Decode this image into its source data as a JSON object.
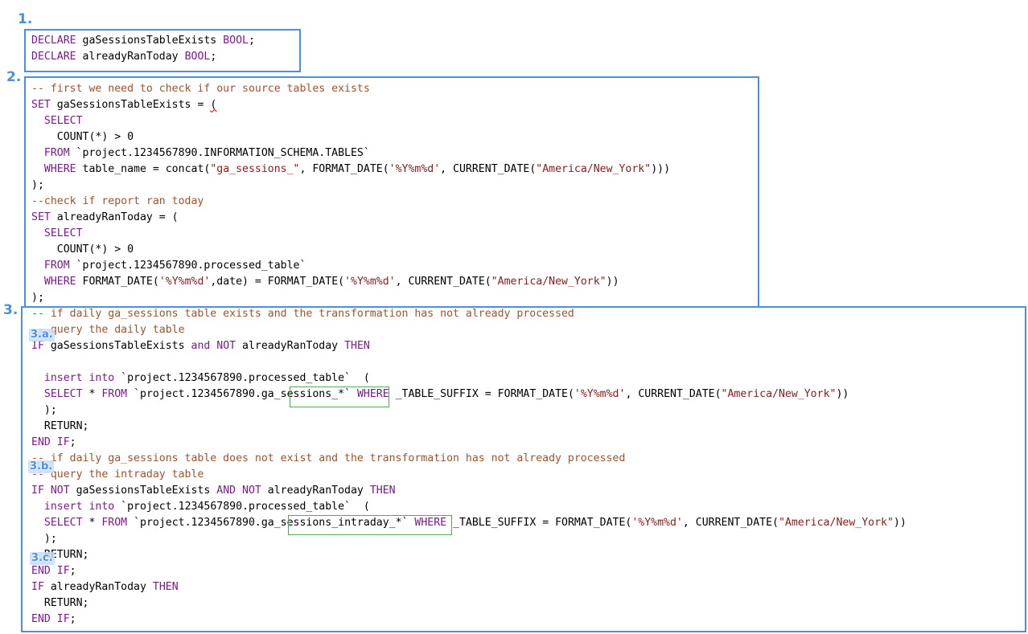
{
  "annotations": {
    "section_1": "1.",
    "section_2": "2.",
    "section_3": "3.",
    "section_3a": "3.a.",
    "section_3b": "3.b.",
    "section_3c": "3.c."
  },
  "colors": {
    "keyword": "#7a1a8c",
    "comment": "#a0522d",
    "string": "#8b1a1a",
    "box": "#4a8fe0",
    "highlight": "#4caf50"
  },
  "code_lines": [
    [
      [
        "kw",
        "DECLARE"
      ],
      [
        "t",
        " gaSessionsTableExists "
      ],
      [
        "kw",
        "BOOL"
      ],
      [
        "t",
        ";"
      ]
    ],
    [
      [
        "kw",
        "DECLARE"
      ],
      [
        "t",
        " alreadyRanToday "
      ],
      [
        "kw",
        "BOOL"
      ],
      [
        "t",
        ";"
      ]
    ],
    [
      [
        "t",
        ""
      ]
    ],
    [
      [
        "cmt",
        "-- first we need to check if our source tables exists"
      ]
    ],
    [
      [
        "kw",
        "SET"
      ],
      [
        "t",
        " gaSessionsTableExists = "
      ],
      [
        "sq",
        "("
      ]
    ],
    [
      [
        "t",
        "  "
      ],
      [
        "kw",
        "SELECT"
      ]
    ],
    [
      [
        "t",
        "    COUNT(*) > 0"
      ]
    ],
    [
      [
        "t",
        "  "
      ],
      [
        "kw",
        "FROM"
      ],
      [
        "t",
        " `project.1234567890.INFORMATION_SCHEMA.TABLES`"
      ]
    ],
    [
      [
        "t",
        "  "
      ],
      [
        "kw",
        "WHERE"
      ],
      [
        "t",
        " table_name = concat("
      ],
      [
        "str",
        "\"ga_sessions_\""
      ],
      [
        "t",
        ", FORMAT_DATE("
      ],
      [
        "str",
        "'%Y%m%d'"
      ],
      [
        "t",
        ", CURRENT_DATE("
      ],
      [
        "str",
        "\"America/New_York\""
      ],
      [
        "t",
        ")))"
      ]
    ],
    [
      [
        "t",
        ");"
      ]
    ],
    [
      [
        "cmt",
        "--check if report ran today"
      ]
    ],
    [
      [
        "kw",
        "SET"
      ],
      [
        "t",
        " alreadyRanToday = ("
      ]
    ],
    [
      [
        "t",
        "  "
      ],
      [
        "kw",
        "SELECT"
      ]
    ],
    [
      [
        "t",
        "    COUNT(*) > 0"
      ]
    ],
    [
      [
        "t",
        "  "
      ],
      [
        "kw",
        "FROM"
      ],
      [
        "t",
        " `project.1234567890.processed_table`"
      ]
    ],
    [
      [
        "t",
        "  "
      ],
      [
        "kw",
        "WHERE"
      ],
      [
        "t",
        " FORMAT_DATE("
      ],
      [
        "str",
        "'%Y%m%d'"
      ],
      [
        "t",
        ",date) = FORMAT_DATE("
      ],
      [
        "str",
        "'%Y%m%d'"
      ],
      [
        "t",
        ", CURRENT_DATE("
      ],
      [
        "str",
        "\"America/New_York\""
      ],
      [
        "t",
        "))"
      ]
    ],
    [
      [
        "t",
        ");"
      ]
    ],
    [
      [
        "cmt",
        "-- if daily ga_sessions table exists and the transformation has not already processed"
      ]
    ],
    [
      [
        "cmt",
        "-- query the daily table"
      ]
    ],
    [
      [
        "kw",
        "IF"
      ],
      [
        "t",
        " gaSessionsTableExists "
      ],
      [
        "kw",
        "and NOT"
      ],
      [
        "t",
        " alreadyRanToday "
      ],
      [
        "kw",
        "THEN"
      ]
    ],
    [
      [
        "t",
        ""
      ]
    ],
    [
      [
        "t",
        "  "
      ],
      [
        "kw",
        "insert into"
      ],
      [
        "t",
        " `project.1234567890.processed_table`  ("
      ]
    ],
    [
      [
        "t",
        "  "
      ],
      [
        "kw",
        "SELECT"
      ],
      [
        "t",
        " * "
      ],
      [
        "kw",
        "FROM"
      ],
      [
        "t",
        " `project.1234567890.ga_sessions_*` "
      ],
      [
        "kw",
        "WHERE"
      ],
      [
        "t",
        " _TABLE_SUFFIX = FORMAT_DATE("
      ],
      [
        "str",
        "'%Y%m%d'"
      ],
      [
        "t",
        ", CURRENT_DATE("
      ],
      [
        "str",
        "\"America/New_York\""
      ],
      [
        "t",
        "))"
      ]
    ],
    [
      [
        "t",
        "  );"
      ]
    ],
    [
      [
        "t",
        "  RETURN;"
      ]
    ],
    [
      [
        "kw",
        "END IF"
      ],
      [
        "t",
        ";"
      ]
    ],
    [
      [
        "cmt",
        "-- if daily ga_sessions table does not exist and the transformation has not already processed"
      ]
    ],
    [
      [
        "cmt",
        "-- query the intraday table"
      ]
    ],
    [
      [
        "kw",
        "IF NOT"
      ],
      [
        "t",
        " gaSessionsTableExists "
      ],
      [
        "kw",
        "AND NOT"
      ],
      [
        "t",
        " alreadyRanToday "
      ],
      [
        "kw",
        "THEN"
      ]
    ],
    [
      [
        "t",
        "  "
      ],
      [
        "kw",
        "insert into"
      ],
      [
        "t",
        " `project.1234567890.processed_table`  ("
      ]
    ],
    [
      [
        "t",
        "  "
      ],
      [
        "kw",
        "SELECT"
      ],
      [
        "t",
        " * "
      ],
      [
        "kw",
        "FROM"
      ],
      [
        "t",
        " `project.1234567890.ga_sessions_intraday_*` "
      ],
      [
        "kw",
        "WHERE"
      ],
      [
        "t",
        " _TABLE_SUFFIX = FORMAT_DATE("
      ],
      [
        "str",
        "'%Y%m%d'"
      ],
      [
        "t",
        ", CURRENT_DATE("
      ],
      [
        "str",
        "\"America/New_York\""
      ],
      [
        "t",
        "))"
      ]
    ],
    [
      [
        "t",
        "  );"
      ]
    ],
    [
      [
        "t",
        "  RETURN;"
      ]
    ],
    [
      [
        "kw",
        "END IF"
      ],
      [
        "t",
        ";"
      ]
    ],
    [
      [
        "kw",
        "IF"
      ],
      [
        "t",
        " alreadyRanToday "
      ],
      [
        "kw",
        "THEN"
      ]
    ],
    [
      [
        "t",
        "  RETURN;"
      ]
    ],
    [
      [
        "kw",
        "END IF"
      ],
      [
        "t",
        ";"
      ]
    ]
  ]
}
